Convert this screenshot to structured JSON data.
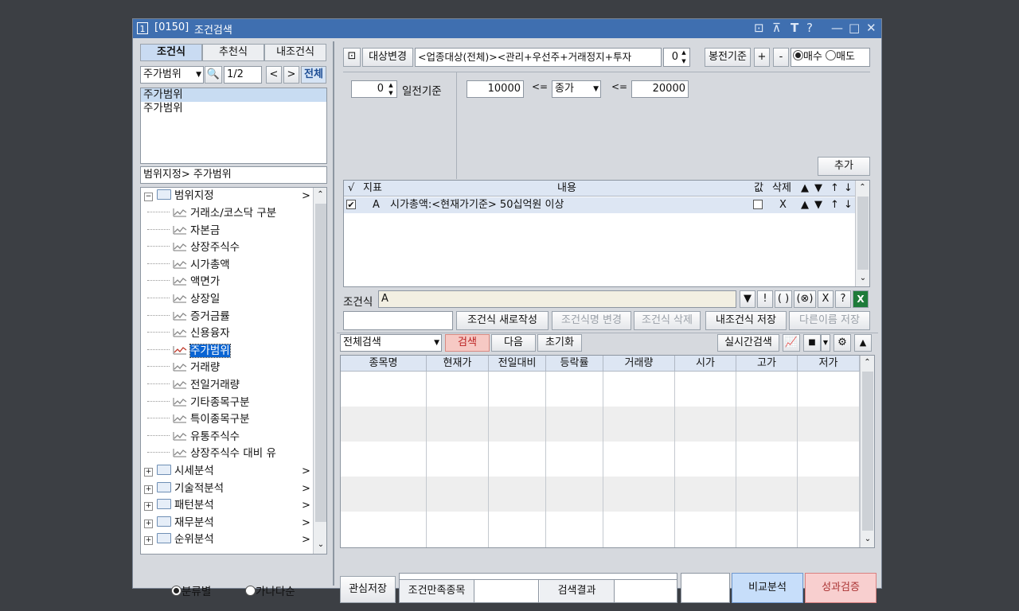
{
  "window": {
    "number": "1",
    "code": "[0150]",
    "title": "조건검색"
  },
  "left": {
    "tabs": [
      "조건식",
      "추천식",
      "내조건식"
    ],
    "category_select": "주가범위",
    "page": "1/2",
    "all_button": "전체",
    "list_items": [
      "주가범위",
      "주가범위"
    ],
    "range_path": "범위지정> 주가범위",
    "tree": {
      "group_open": "범위지정",
      "children": [
        "거래소/코스닥 구분",
        "자본금",
        "상장주식수",
        "시가총액",
        "액면가",
        "상장일",
        "증거금률",
        "신용융자",
        "주가범위",
        "거래량",
        "전일거래량",
        "기타종목구분",
        "특이종목구분",
        "유통주식수",
        "상장주식수 대비 유"
      ],
      "selected": "주가범위",
      "groups": [
        "시세분석",
        "기술적분석",
        "패턴분석",
        "재무분석",
        "순위분석"
      ],
      "arrow": ">"
    },
    "sort_options": [
      "분류별",
      "가나다순"
    ]
  },
  "top": {
    "target_change": "대상변경",
    "target_text": "<업종대상(전체)><관리+우선주+거래정지+투자",
    "bong_value": "0",
    "bong_label": "봉전기준",
    "plus": "+",
    "minus": "-",
    "buy": "매수",
    "sell": "매도"
  },
  "editor": {
    "day_value": "0",
    "day_label": "일전기준",
    "min_value": "10000",
    "op1": "<=",
    "price_type": "종가",
    "op2": "<=",
    "max_value": "20000",
    "add_button": "추가"
  },
  "cond_table": {
    "headers": [
      "√",
      "지표",
      "내용",
      "값",
      "삭제",
      "▲",
      "▼",
      "↑",
      "↓"
    ],
    "rows": [
      {
        "checked": "✔",
        "id": "A",
        "content": "시가총액:<현재가기준> 50십억원 이상",
        "del": "X",
        "up": "▲",
        "down": "▼",
        "top": "↑",
        "bottom": "↓"
      }
    ]
  },
  "formula": {
    "label": "조건식",
    "value": "A",
    "buttons": [
      "▼",
      "!",
      "( )",
      "(⊗)",
      "X",
      "?"
    ]
  },
  "actions": {
    "new": "조건식 새로작성",
    "rename": "조건식명 변경",
    "delete": "조건식 삭제",
    "save": "내조건식 저장",
    "save_as": "다른이름 저장"
  },
  "search": {
    "mode": "전체검색",
    "search": "검색",
    "next": "다음",
    "reset": "초기화",
    "realtime": "실시간검색"
  },
  "results": {
    "columns": [
      "종목명",
      "현재가",
      "전일대비",
      "등락률",
      "거래량",
      "시가",
      "고가",
      "저가"
    ]
  },
  "bottom": {
    "watch_save": "관심저장",
    "satisfied_label": "조건만족종목",
    "result_label": "검색결과",
    "compare": "비교분석",
    "verify": "성과검증"
  },
  "colors": {
    "titlebar": "#3f6fb0",
    "selection": "#0a64d2",
    "search_button": "#f6c9c4",
    "compare_button": "#c7defa",
    "verify_button": "#f8cfcf"
  }
}
